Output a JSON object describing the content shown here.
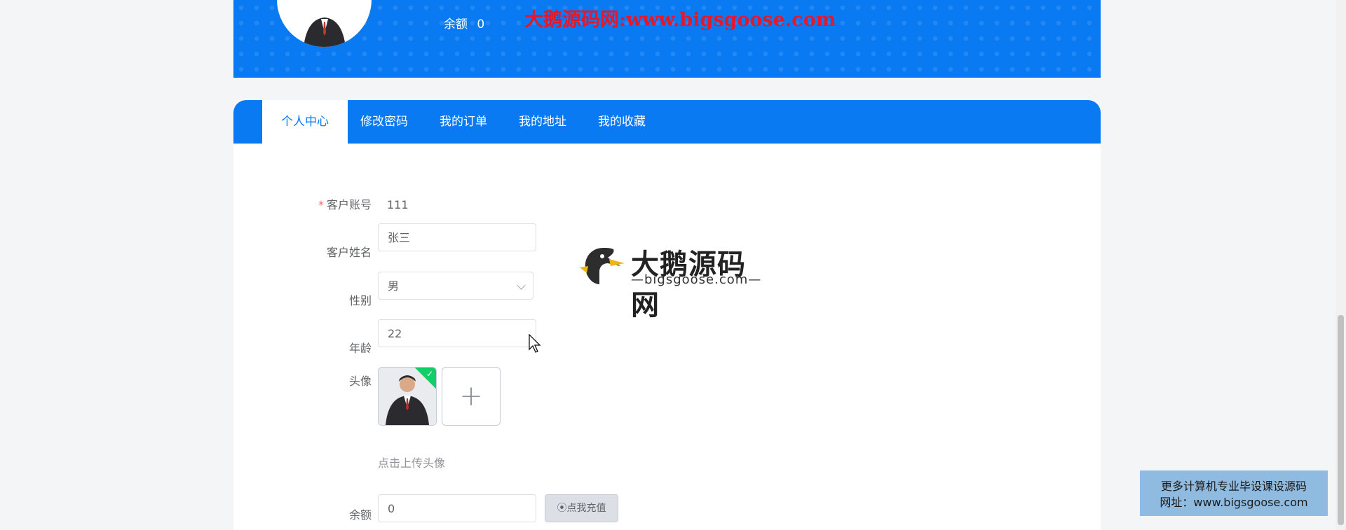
{
  "banner": {
    "balance_label": "余额",
    "balance_value": "0",
    "watermark": "大鹅源码网:www.bigsgoose.com"
  },
  "tabs": [
    {
      "label": "个人中心",
      "active": true
    },
    {
      "label": "修改密码"
    },
    {
      "label": "我的订单"
    },
    {
      "label": "我的地址"
    },
    {
      "label": "我的收藏"
    }
  ],
  "form": {
    "account_label": "客户账号",
    "account_value": "111",
    "name_label": "客户姓名",
    "name_value": "张三",
    "gender_label": "性别",
    "gender_value": "男",
    "age_label": "年龄",
    "age_value": "22",
    "avatar_label": "头像",
    "upload_plus": "+",
    "upload_hint": "点击上传头像",
    "balance_label": "余额",
    "balance_value": "0",
    "recharge_button": "点我充值"
  },
  "logo": {
    "title": "大鹅源码网",
    "subtitle": "—bigsgoose.com—"
  },
  "corner_box": {
    "line1": "更多计算机专业毕设课设源码",
    "line2": "网址：www.bigsgoose.com"
  },
  "colors": {
    "primary": "#0a7af3",
    "watermark": "#e5172b",
    "success": "#13ce66"
  }
}
